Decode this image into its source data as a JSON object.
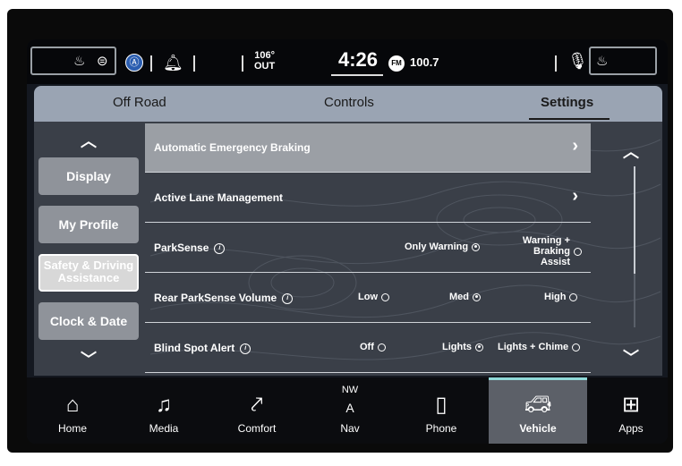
{
  "status": {
    "temperature": "106°",
    "temperature_label": "OUT",
    "time": "4:26",
    "radio_band": "FM",
    "radio_station": "100.7"
  },
  "tabs": [
    {
      "label": "Off Road"
    },
    {
      "label": "Controls"
    },
    {
      "label": "Settings"
    }
  ],
  "sidebar": {
    "items": [
      {
        "label": "Display"
      },
      {
        "label": "My Profile"
      },
      {
        "label": "Safety & Driving Assistance"
      },
      {
        "label": "Clock & Date"
      }
    ]
  },
  "settings": {
    "automatic_emergency_braking": "Automatic Emergency Braking",
    "active_lane_management": "Active Lane Management",
    "parksense": {
      "label": "ParkSense",
      "options": [
        "Only Warning",
        "Warning + Braking Assist"
      ],
      "selected": "Only Warning"
    },
    "rear_parksense_volume": {
      "label": "Rear ParkSense Volume",
      "options": [
        "Low",
        "Med",
        "High"
      ],
      "selected": "Med"
    },
    "blind_spot_alert": {
      "label": "Blind Spot Alert",
      "options": [
        "Off",
        "Lights",
        "Lights + Chime"
      ],
      "selected": "Lights"
    }
  },
  "navbar": {
    "home": "Home",
    "media": "Media",
    "comfort": "Comfort",
    "nav_heading": "NW",
    "nav_arrow": "A",
    "nav": "Nav",
    "phone": "Phone",
    "vehicle": "Vehicle",
    "apps": "Apps"
  },
  "colors": {
    "accent": "#8fd8d8",
    "tabbar": "#9aa4b3",
    "highlight_row": "#9b9fa5"
  }
}
